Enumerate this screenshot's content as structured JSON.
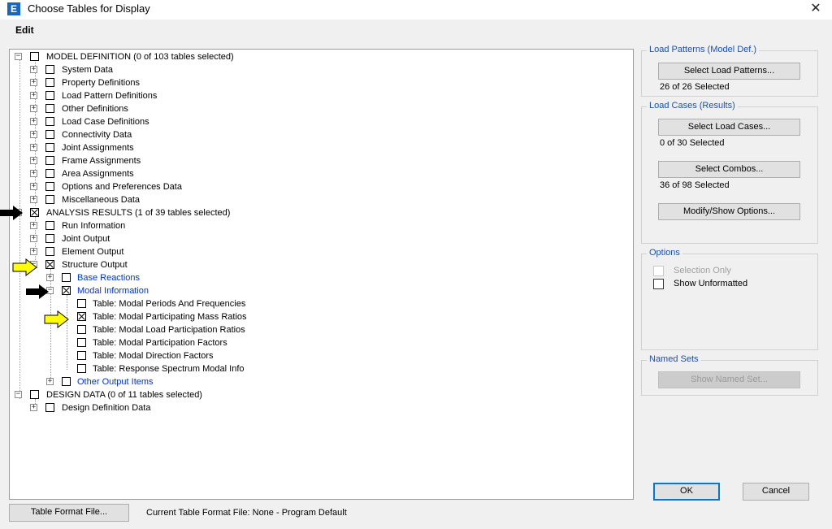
{
  "window": {
    "title": "Choose Tables for Display",
    "app_icon": "E",
    "close_glyph": "✕"
  },
  "menu": {
    "edit": "Edit"
  },
  "tree": [
    {
      "label": "MODEL DEFINITION  (0 of 103 tables selected)",
      "state": "unchecked"
    },
    {
      "label": "System Data",
      "state": "unchecked"
    },
    {
      "label": "Property Definitions",
      "state": "unchecked"
    },
    {
      "label": "Load Pattern Definitions",
      "state": "unchecked"
    },
    {
      "label": "Other Definitions",
      "state": "unchecked"
    },
    {
      "label": "Load Case Definitions",
      "state": "unchecked"
    },
    {
      "label": "Connectivity Data",
      "state": "unchecked"
    },
    {
      "label": "Joint Assignments",
      "state": "unchecked"
    },
    {
      "label": "Frame Assignments",
      "state": "unchecked"
    },
    {
      "label": "Area Assignments",
      "state": "unchecked"
    },
    {
      "label": "Options and Preferences Data",
      "state": "unchecked"
    },
    {
      "label": "Miscellaneous Data",
      "state": "unchecked"
    },
    {
      "label": "ANALYSIS RESULTS  (1 of 39 tables selected)",
      "state": "checked"
    },
    {
      "label": "Run Information",
      "state": "unchecked"
    },
    {
      "label": "Joint Output",
      "state": "unchecked"
    },
    {
      "label": "Element Output",
      "state": "unchecked"
    },
    {
      "label": "Structure Output",
      "state": "checked"
    },
    {
      "label": "Base Reactions",
      "state": "unchecked"
    },
    {
      "label": "Modal Information",
      "state": "checked"
    },
    {
      "label": "Table:  Modal Periods And Frequencies",
      "state": "unchecked"
    },
    {
      "label": "Table:  Modal Participating Mass Ratios",
      "state": "checked"
    },
    {
      "label": "Table:  Modal Load Participation Ratios",
      "state": "unchecked"
    },
    {
      "label": "Table:  Modal Participation Factors",
      "state": "unchecked"
    },
    {
      "label": "Table:  Modal Direction Factors",
      "state": "unchecked"
    },
    {
      "label": "Table:  Response Spectrum Modal Info",
      "state": "unchecked"
    },
    {
      "label": "Other Output Items",
      "state": "unchecked"
    },
    {
      "label": "DESIGN DATA  (0 of 11 tables selected)",
      "state": "unchecked"
    },
    {
      "label": "Design Definition Data",
      "state": "unchecked"
    }
  ],
  "load_patterns": {
    "title": "Load Patterns (Model Def.)",
    "button": "Select Load Patterns...",
    "status": "26 of 26 Selected"
  },
  "load_cases": {
    "title": "Load Cases (Results)",
    "cases_button": "Select Load Cases...",
    "cases_status": "0 of 30 Selected",
    "combos_button": "Select Combos...",
    "combos_status": "36 of 98 Selected",
    "options_button": "Modify/Show Options..."
  },
  "options": {
    "title": "Options",
    "selection_only": "Selection Only",
    "show_unformatted": "Show Unformatted"
  },
  "named_sets": {
    "title": "Named Sets",
    "button": "Show Named Set..."
  },
  "footer": {
    "ok": "OK",
    "cancel": "Cancel",
    "table_format_button": "Table Format File...",
    "format_label": "Current Table Format File:  None - Program Default"
  },
  "colors": {
    "group_title": "#1a50b0",
    "link_blue": "#0033dd",
    "selection": "#1a5fd6",
    "arrow_black": "#000000",
    "arrow_yellow": "#ffff00"
  },
  "icons": [
    "expand-icon",
    "collapse-icon",
    "checkbox-icon",
    "black-arrow-icon",
    "yellow-arrow-icon",
    "close-icon"
  ]
}
